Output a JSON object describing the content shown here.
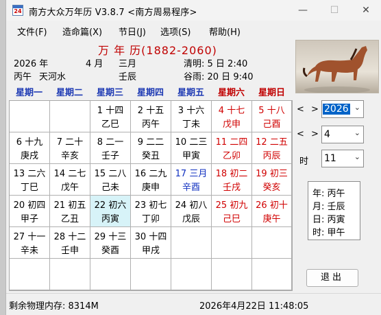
{
  "window": {
    "title": "南方大众万年历  V3.8.7  <南方周易程序>",
    "icon_text": "24",
    "minimize_glyph": "—",
    "maximize_glyph": "☐",
    "close_glyph": "✕"
  },
  "menu": [
    "文件(F)",
    "造命篇(X)",
    "节日(J)",
    "选项(S)",
    "帮助(H)"
  ],
  "header": {
    "title": "万  年  历(1882-2060)",
    "year_label": "2026 年",
    "month_num": "4  月",
    "lunar_month": "三月",
    "qingming": "清明: 5  日  2:40",
    "ganzhi_year": "丙午",
    "nayin": "天河水",
    "ganzhi_month": "壬辰",
    "guyu": "谷雨: 20  日  9:40"
  },
  "weekdays": [
    "星期一",
    "星期二",
    "星期三",
    "星期四",
    "星期五",
    "星期六",
    "星期日"
  ],
  "calendar": {
    "rows": [
      [
        null,
        null,
        {
          "top": "1  十四",
          "bot": "乙巳",
          "color": ""
        },
        {
          "top": "2  十五",
          "bot": "丙午",
          "color": ""
        },
        {
          "top": "3  十六",
          "bot": "丁未",
          "color": ""
        },
        {
          "top": "4  十七",
          "bot": "戊申",
          "color": "red"
        },
        {
          "top": "5  十八",
          "bot": "己酉",
          "color": "red"
        }
      ],
      [
        {
          "top": "6  十九",
          "bot": "庚戌",
          "color": ""
        },
        {
          "top": "7  二十",
          "bot": "辛亥",
          "color": ""
        },
        {
          "top": "8  二一",
          "bot": "壬子",
          "color": ""
        },
        {
          "top": "9  二二",
          "bot": "癸丑",
          "color": ""
        },
        {
          "top": "10 二三",
          "bot": "甲寅",
          "color": ""
        },
        {
          "top": "11 二四",
          "bot": "乙卯",
          "color": "red"
        },
        {
          "top": "12 二五",
          "bot": "丙辰",
          "color": "red"
        }
      ],
      [
        {
          "top": "13 二六",
          "bot": "丁巳",
          "color": ""
        },
        {
          "top": "14 二七",
          "bot": "戊午",
          "color": ""
        },
        {
          "top": "15 二八",
          "bot": "己未",
          "color": ""
        },
        {
          "top": "16 二九",
          "bot": "庚申",
          "color": ""
        },
        {
          "top": "17 三月",
          "bot": "辛酉",
          "color": "blue"
        },
        {
          "top": "18 初二",
          "bot": "壬戌",
          "color": "red"
        },
        {
          "top": "19 初三",
          "bot": "癸亥",
          "color": "red"
        }
      ],
      [
        {
          "top": "20 初四",
          "bot": "甲子",
          "color": ""
        },
        {
          "top": "21 初五",
          "bot": "乙丑",
          "color": ""
        },
        {
          "top": "22 初六",
          "bot": "丙寅",
          "color": "",
          "today": true
        },
        {
          "top": "23 初七",
          "bot": "丁卯",
          "color": ""
        },
        {
          "top": "24 初八",
          "bot": "戊辰",
          "color": ""
        },
        {
          "top": "25 初九",
          "bot": "己巳",
          "color": "red"
        },
        {
          "top": "26 初十",
          "bot": "庚午",
          "color": "red"
        }
      ],
      [
        {
          "top": "27 十一",
          "bot": "辛未",
          "color": ""
        },
        {
          "top": "28 十二",
          "bot": "壬申",
          "color": ""
        },
        {
          "top": "29 十三",
          "bot": "癸酉",
          "color": ""
        },
        {
          "top": "30 十四",
          "bot": "甲戌",
          "color": ""
        },
        null,
        null,
        null
      ],
      [
        null,
        null,
        null,
        null,
        null,
        null,
        null
      ]
    ]
  },
  "controls": {
    "arrow_glyph": "< >",
    "year_value": "2026",
    "month_value": "4",
    "hour_label": "时",
    "hour_value": "11",
    "chevron_glyph": "⌄"
  },
  "ganzhi_panel": {
    "year": "年:  丙午",
    "month": "月:  壬辰",
    "day": "日:  丙寅",
    "hour": "时:  甲午"
  },
  "exit_label": "退出",
  "status": {
    "memory": "剩余物理内存:    8314M",
    "datetime": "2026年4月22日  11:48:05"
  }
}
